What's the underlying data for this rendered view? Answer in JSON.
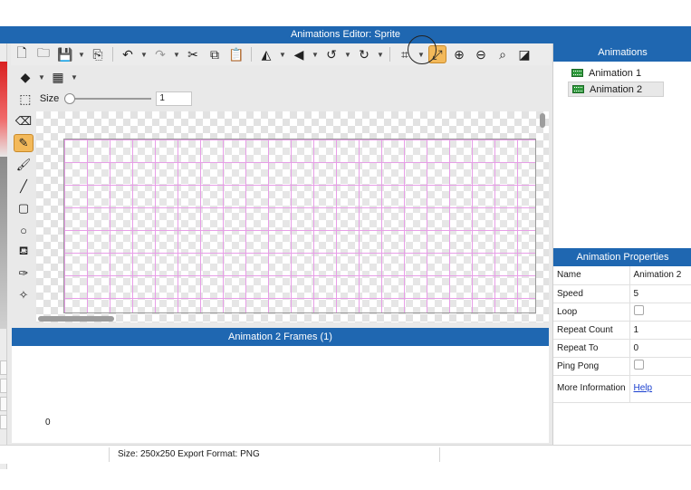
{
  "window": {
    "title": "Animations Editor: Sprite"
  },
  "toolbar": {
    "buttons": [
      {
        "name": "new-file-icon",
        "glyph": "🗋"
      },
      {
        "name": "open-folder-icon",
        "glyph": "🗀"
      },
      {
        "name": "save-icon",
        "glyph": "💾"
      },
      {
        "name": "export-icon",
        "glyph": "⎘"
      },
      {
        "name": "undo-icon",
        "glyph": "↶"
      },
      {
        "name": "redo-icon",
        "glyph": "↷"
      },
      {
        "name": "cut-icon",
        "glyph": "✂"
      },
      {
        "name": "copy-icon",
        "glyph": "⧉"
      },
      {
        "name": "paste-icon",
        "glyph": "📋"
      },
      {
        "name": "flip-horizontal-icon",
        "glyph": "◭"
      },
      {
        "name": "flip-vertical-icon",
        "glyph": "◀"
      },
      {
        "name": "rotate-left-icon",
        "glyph": "↺"
      },
      {
        "name": "rotate-right-icon",
        "glyph": "↻"
      },
      {
        "name": "crop-icon",
        "glyph": "⌗"
      },
      {
        "name": "resize-icon",
        "glyph": "⤢"
      },
      {
        "name": "zoom-in-icon",
        "glyph": "⊕"
      },
      {
        "name": "zoom-out-icon",
        "glyph": "⊖"
      },
      {
        "name": "zoom-actual-icon",
        "glyph": "⌕"
      },
      {
        "name": "fit-icon",
        "glyph": "◪"
      }
    ],
    "layers_icon": "◆",
    "grid_icon": "▦",
    "selection_icon": "⬚"
  },
  "size_control": {
    "label": "Size",
    "value": "1"
  },
  "tools": [
    {
      "name": "eraser-icon",
      "glyph": "⌫"
    },
    {
      "name": "pencil-icon",
      "glyph": "✎"
    },
    {
      "name": "brush-icon",
      "glyph": "🖌"
    },
    {
      "name": "line-icon",
      "glyph": "╱"
    },
    {
      "name": "rectangle-icon",
      "glyph": "▢"
    },
    {
      "name": "ellipse-icon",
      "glyph": "○"
    },
    {
      "name": "paint-bucket-icon",
      "glyph": "⛾"
    },
    {
      "name": "eyedropper-icon",
      "glyph": "✑"
    },
    {
      "name": "magic-wand-icon",
      "glyph": "✧"
    }
  ],
  "frames": {
    "title": "Animation 2 Frames (1)",
    "frame_number": "0"
  },
  "status": {
    "text": "Size: 250x250   Export Format: PNG"
  },
  "animations": {
    "title": "Animations",
    "items": [
      {
        "label": "Animation 1",
        "selected": false
      },
      {
        "label": "Animation 2",
        "selected": true
      }
    ]
  },
  "properties": {
    "title": "Animation Properties",
    "rows": {
      "name": {
        "key": "Name",
        "value": "Animation 2"
      },
      "speed": {
        "key": "Speed",
        "value": "5"
      },
      "loop": {
        "key": "Loop"
      },
      "repeat_count": {
        "key": "Repeat Count",
        "value": "1"
      },
      "repeat_to": {
        "key": "Repeat To",
        "value": "0"
      },
      "ping_pong": {
        "key": "Ping Pong"
      },
      "more_info": {
        "key": "More Information",
        "value": "Help"
      }
    }
  },
  "colors": {
    "header_blue": "#1f67b1",
    "active_tool": "#f3b95a",
    "grid_line": "#e79ee7"
  }
}
